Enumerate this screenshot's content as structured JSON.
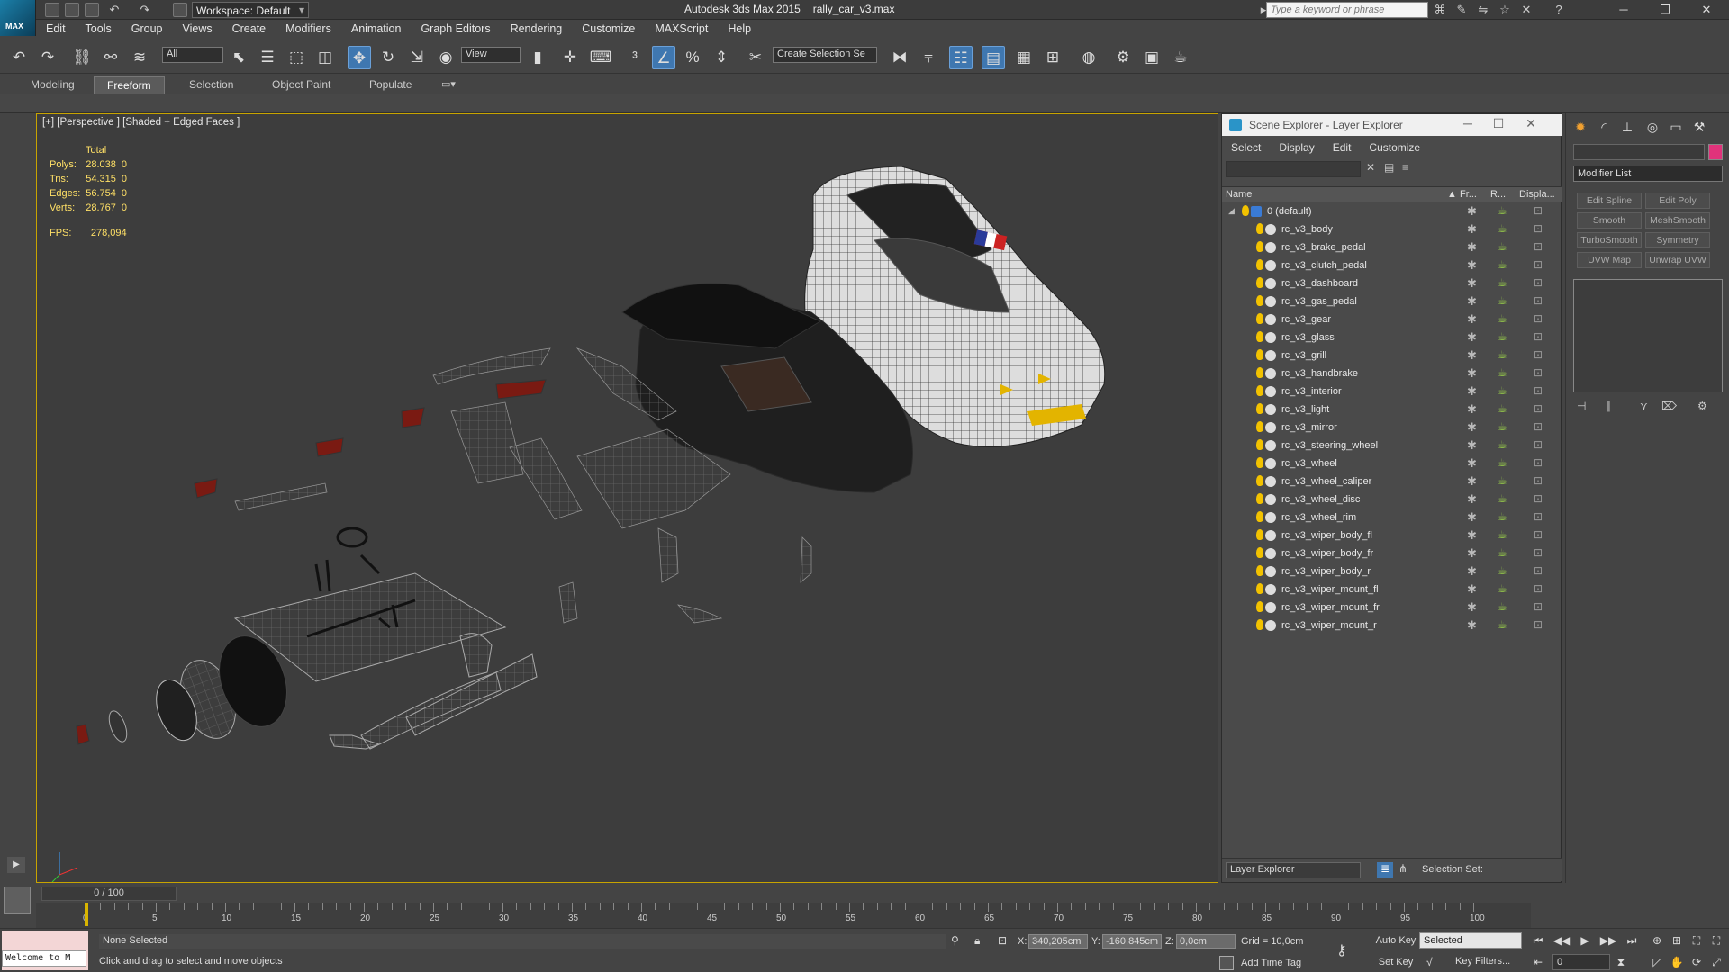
{
  "app": {
    "title": "Autodesk 3ds Max  2015",
    "file": "rally_car_v3.max",
    "logo_text": "MAX",
    "workspace": "Workspace: Default",
    "search_placeholder": "Type a keyword or phrase"
  },
  "menu": [
    "Edit",
    "Tools",
    "Group",
    "Views",
    "Create",
    "Modifiers",
    "Animation",
    "Graph Editors",
    "Rendering",
    "Customize",
    "MAXScript",
    "Help"
  ],
  "toolbar": {
    "selection_filter": "All",
    "ref_coord": "View",
    "named_selection": "Create Selection Se"
  },
  "ribbon_tabs": [
    "Modeling",
    "Freeform",
    "Selection",
    "Object Paint",
    "Populate"
  ],
  "ribbon_active": "Freeform",
  "viewport": {
    "label": "[+] [Perspective ] [Shaded + Edged Faces ]",
    "stats": {
      "header": "Total",
      "rows": [
        {
          "k": "Polys:",
          "v": "28.038",
          "s": "0"
        },
        {
          "k": "Tris:",
          "v": "54.315",
          "s": "0"
        },
        {
          "k": "Edges:",
          "v": "56.754",
          "s": "0"
        },
        {
          "k": "Verts:",
          "v": "28.767",
          "s": "0"
        }
      ],
      "fps_label": "FPS:",
      "fps": "278,094"
    }
  },
  "scene_explorer": {
    "title": "Scene Explorer - Layer Explorer",
    "menu": [
      "Select",
      "Display",
      "Edit",
      "Customize"
    ],
    "columns": {
      "name": "Name",
      "freeze": "Fr...",
      "render": "R...",
      "display": "Displa..."
    },
    "root": "0 (default)",
    "layers": [
      "rc_v3_body",
      "rc_v3_brake_pedal",
      "rc_v3_clutch_pedal",
      "rc_v3_dashboard",
      "rc_v3_gas_pedal",
      "rc_v3_gear",
      "rc_v3_glass",
      "rc_v3_grill",
      "rc_v3_handbrake",
      "rc_v3_interior",
      "rc_v3_light",
      "rc_v3_mirror",
      "rc_v3_steering_wheel",
      "rc_v3_wheel",
      "rc_v3_wheel_caliper",
      "rc_v3_wheel_disc",
      "rc_v3_wheel_rim",
      "rc_v3_wiper_body_fl",
      "rc_v3_wiper_body_fr",
      "rc_v3_wiper_body_r",
      "rc_v3_wiper_mount_fl",
      "rc_v3_wiper_mount_fr",
      "rc_v3_wiper_mount_r"
    ],
    "footer_mode": "Layer Explorer",
    "selection_set": "Selection Set:"
  },
  "command_panel": {
    "modifier_list": "Modifier List",
    "buttons": [
      "Edit Spline",
      "Edit Poly",
      "Smooth",
      "MeshSmooth",
      "TurboSmooth",
      "Symmetry",
      "UVW Map",
      "Unwrap UVW"
    ],
    "object_color": "#e0337b"
  },
  "timeline": {
    "frame": "0 / 100",
    "ticks": [
      "0",
      "5",
      "10",
      "15",
      "20",
      "25",
      "30",
      "35",
      "40",
      "45",
      "50",
      "55",
      "60",
      "65",
      "70",
      "75",
      "80",
      "85",
      "90",
      "95",
      "100"
    ]
  },
  "status": {
    "listener": "Welcome to M",
    "selection": "None Selected",
    "prompt": "Click and drag to select and move objects",
    "x": "340,205cm",
    "y": "-160,845cm",
    "z": "0,0cm",
    "grid": "Grid = 10,0cm",
    "add_time_tag": "Add Time Tag",
    "auto_key": "Auto Key",
    "set_key": "Set Key",
    "selected": "Selected",
    "key_filters": "Key Filters...",
    "frame_field": "0"
  }
}
